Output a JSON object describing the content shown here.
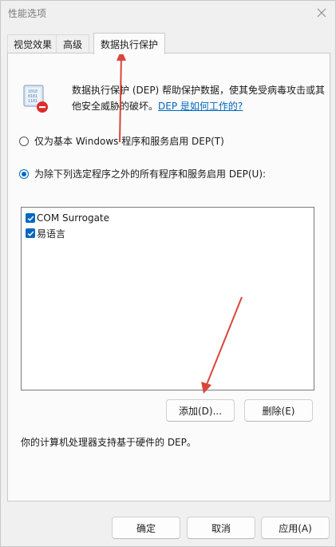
{
  "window": {
    "title": "性能选项"
  },
  "tabs": [
    {
      "label": "视觉效果"
    },
    {
      "label": "高级"
    },
    {
      "label": "数据执行保护"
    }
  ],
  "dep": {
    "description": "数据执行保护 (DEP) 帮助保护数据，使其免受病毒攻击或其他安全威胁的破坏。",
    "link_text": "DEP 是如何工作的?",
    "option_basic": "仅为基本 Windows 程序和服务启用 DEP(T)",
    "option_all": "为除下列选定程序之外的所有程序和服务启用 DEP(U):",
    "selected_option": "option_all",
    "programs": [
      {
        "name": "COM Surrogate",
        "checked": true
      },
      {
        "name": "易语言",
        "checked": true
      }
    ],
    "add_button": "添加(D)...",
    "remove_button": "删除(E)",
    "hardware_note": "你的计算机处理器支持基于硬件的 DEP。"
  },
  "footer": {
    "ok": "确定",
    "cancel": "取消",
    "apply": "应用(A)"
  },
  "annotation_color": "#d9463b"
}
